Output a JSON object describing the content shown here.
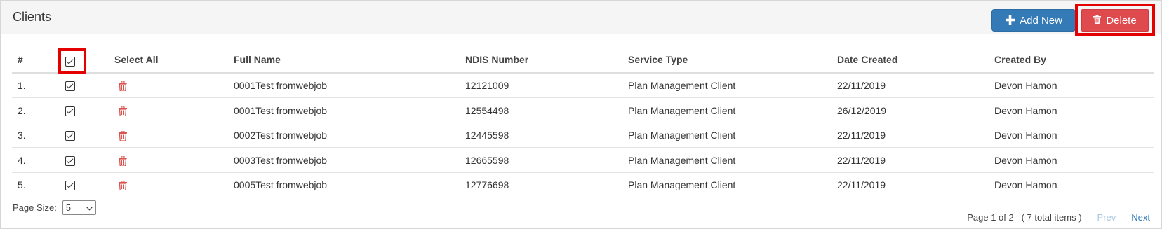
{
  "panel": {
    "title": "Clients"
  },
  "toolbar": {
    "add_label": "Add New",
    "delete_label": "Delete",
    "add_icon": "plus-icon",
    "delete_icon": "trash-icon",
    "add_color": "#337ab7",
    "delete_color": "#df4a4f",
    "highlight_color": "#e50000"
  },
  "table": {
    "headers": {
      "num": "#",
      "select_all": "Select All",
      "full_name": "Full Name",
      "ndis": "NDIS Number",
      "service": "Service Type",
      "date": "Date Created",
      "created_by": "Created By"
    },
    "select_all_checked": true,
    "rows": [
      {
        "num": "1.",
        "checked": true,
        "name": "0001Test fromwebjob",
        "ndis": "12121009",
        "service": "Plan Management Client",
        "date": "22/11/2019",
        "created_by": "Devon Hamon"
      },
      {
        "num": "2.",
        "checked": true,
        "name": "0001Test fromwebjob",
        "ndis": "12554498",
        "service": "Plan Management Client",
        "date": "26/12/2019",
        "created_by": "Devon Hamon"
      },
      {
        "num": "3.",
        "checked": true,
        "name": "0002Test fromwebjob",
        "ndis": "12445598",
        "service": "Plan Management Client",
        "date": "22/11/2019",
        "created_by": "Devon Hamon"
      },
      {
        "num": "4.",
        "checked": true,
        "name": "0003Test fromwebjob",
        "ndis": "12665598",
        "service": "Plan Management Client",
        "date": "22/11/2019",
        "created_by": "Devon Hamon"
      },
      {
        "num": "5.",
        "checked": true,
        "name": "0005Test fromwebjob",
        "ndis": "12776698",
        "service": "Plan Management Client",
        "date": "22/11/2019",
        "created_by": "Devon Hamon"
      }
    ]
  },
  "footer": {
    "page_size_label": "Page Size:",
    "page_size_value": "5",
    "page_info": "Page 1 of 2",
    "total_items": "( 7 total items )",
    "prev_label": "Prev",
    "next_label": "Next"
  }
}
